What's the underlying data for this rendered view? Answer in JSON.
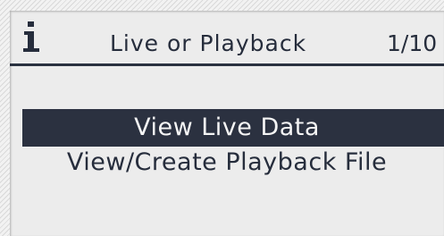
{
  "header": {
    "icon": "info-icon",
    "title": "Live or Playback",
    "page_counter": "1/10"
  },
  "menu": {
    "items": [
      {
        "label": "View Live Data",
        "selected": true
      },
      {
        "label": "View/Create Playback File",
        "selected": false
      }
    ]
  },
  "colors": {
    "screen_background": "#ececec",
    "text": "#262d3c",
    "selection_background": "#2b3140",
    "selection_text": "#f5f5f5"
  }
}
